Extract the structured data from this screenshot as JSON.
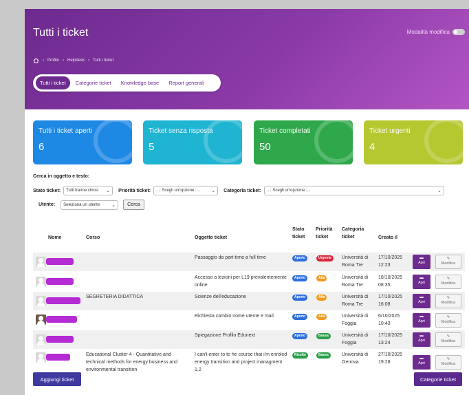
{
  "header": {
    "title": "Tutti i ticket",
    "edit_mode_label": "Modalità modifica",
    "breadcrumb": [
      "Profilo",
      "Helpdesk",
      "Tutti i ticket"
    ]
  },
  "tabs": [
    "Tutti i ticket",
    "Categorie ticket",
    "Knowledge base",
    "Report generali"
  ],
  "cards": [
    {
      "label": "Tutti i ticket aperti",
      "value": "6",
      "color": "#1e88e5"
    },
    {
      "label": "Ticket senza risposta",
      "value": "5",
      "color": "#1eb4d2"
    },
    {
      "label": "Ticket completati",
      "value": "50",
      "color": "#2ea84a"
    },
    {
      "label": "Ticket urgenti",
      "value": "4",
      "color": "#b5c830"
    }
  ],
  "search": {
    "title": "Cerca in oggetto e testo:",
    "stato_label": "Stato ticket:",
    "stato_value": "Tutti tranne chiusi",
    "priorita_label": "Priorità ticket:",
    "priorita_value": "...: Scegli un'opzione :...",
    "categoria_label": "Categoria ticket:",
    "categoria_value": "...: Scegli un'opzione :...",
    "utente_label": "Utente:",
    "utente_value": "Seleziona un utente",
    "cerca_label": "Cerca"
  },
  "table": {
    "headers": {
      "nome": "Nome",
      "corso": "Corso",
      "oggetto": "Oggetto ticket",
      "stato": "Stato ticket",
      "priorita": "Priorità ticket",
      "categoria": "Categoria ticket",
      "creato": "Creato il"
    },
    "rows": [
      {
        "corso": "",
        "oggetto": "Passaggio da part-time a full time",
        "stato": "Aperto",
        "priorita": "Urgente",
        "categoria": "Università di Roma Tre",
        "creato": "17/10/2025 12:23"
      },
      {
        "corso": "",
        "oggetto": "Accesso a lezioni per L19 prevalentemente online",
        "stato": "Aperto",
        "priorita": "Alta",
        "categoria": "Università di Roma Tre",
        "creato": "18/10/2025 08:35"
      },
      {
        "corso": "SEGRETERIA DIDATTICA",
        "oggetto": "Scienze dell'educazione",
        "stato": "Aperto",
        "priorita": "Alta",
        "categoria": "Università di Roma Tre",
        "creato": "17/10/2025 16:08"
      },
      {
        "corso": "",
        "oggetto": "Richiesta cambio nome utente e mail",
        "stato": "Aperto",
        "priorita": "Alta",
        "categoria": "Università di Foggia",
        "creato": "6/10/2025 10:43"
      },
      {
        "corso": "",
        "oggetto": "Spiegazione Profilo Edunext",
        "stato": "Aperto",
        "priorita": "Bassa",
        "categoria": "Università di Foggia",
        "creato": "17/10/2025 13:24"
      },
      {
        "corso": "Educational Cluster 4 - Quantitative and technical methods for energy business and environmental transition",
        "oggetto": "I can't enter to te he course that i'm enroled energy transition and project managment 1,2",
        "stato": "Risolto",
        "priorita": "Bassa",
        "categoria": "Università di Genova",
        "creato": "27/10/2025 19:28"
      }
    ],
    "apri_label": "Apri",
    "modifica_label": "Modifica"
  },
  "footer": {
    "add_label": "Aggiungi ticket",
    "categories_label": "Categorie ticket"
  }
}
